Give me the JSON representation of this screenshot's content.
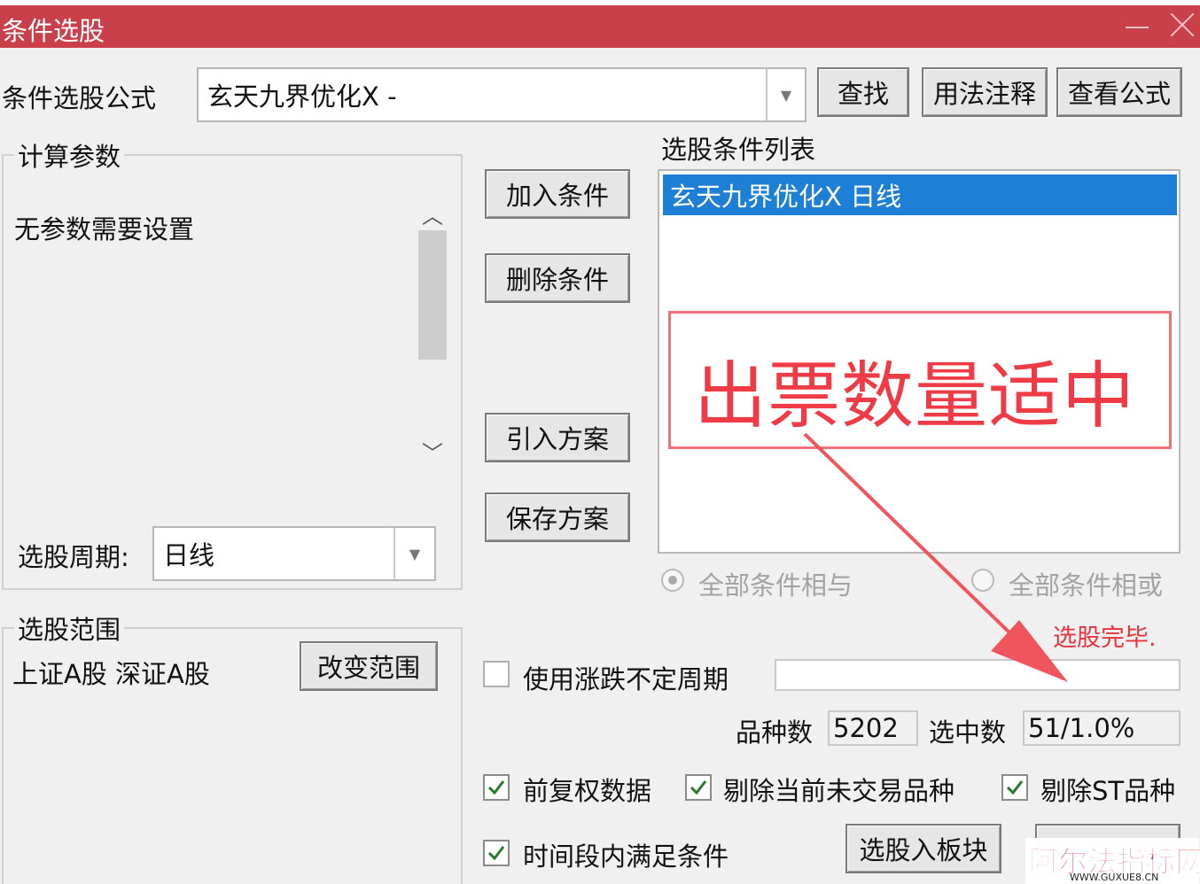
{
  "window": {
    "title": "条件选股"
  },
  "formula": {
    "label": "条件选股公式",
    "value": "玄天九界优化X  -",
    "find_button": "查找",
    "usage_button": "用法注释",
    "view_button": "查看公式"
  },
  "params": {
    "group_label": "计算参数",
    "text": "无参数需要设置",
    "period_label": "选股周期:",
    "period_value": "日线"
  },
  "range": {
    "group_label": "选股范围",
    "value": "上证A股 深证A股",
    "change_button": "改变范围"
  },
  "actions": {
    "add": "加入条件",
    "delete": "删除条件",
    "import": "引入方案",
    "save": "保存方案"
  },
  "conditions": {
    "label": "选股条件列表",
    "items": [
      "玄天九界优化X  日线"
    ],
    "selected_color": "#1e7fd6",
    "radio_and": "全部条件相与",
    "radio_or": "全部条件相或"
  },
  "annotation": {
    "text": "出票数量适中",
    "color": "#ee3b45"
  },
  "status": {
    "text": "选股完毕.",
    "color": "#e8333c"
  },
  "options": {
    "variable_period": "使用涨跌不定周期",
    "count_label": "品种数",
    "count_value": "5202",
    "selected_label": "选中数",
    "selected_value": "51/1.0%",
    "forward_adjust": "前复权数据",
    "exclude_untraded": "剔除当前未交易品种",
    "exclude_st": "剔除ST品种",
    "time_range": "时间段内满足条件",
    "to_block_button": "选股入板块"
  },
  "watermark": {
    "main": "阿尔法指标网",
    "sub": "WWW.GUXUE8.CN"
  },
  "colors": {
    "titlebar": "#c9404a",
    "accent": "#1e7fd6"
  }
}
